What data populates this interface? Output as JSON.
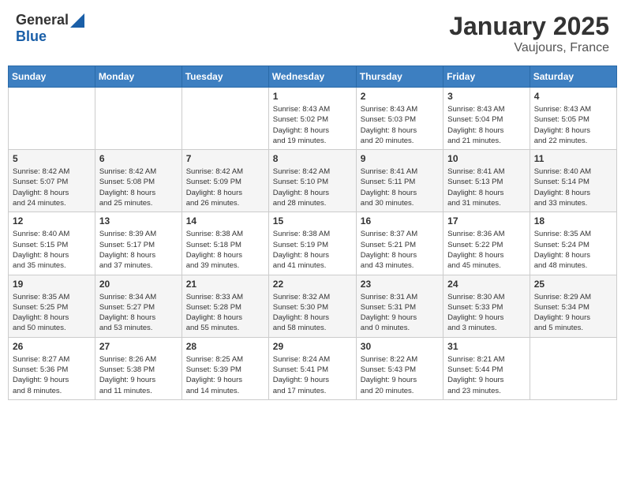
{
  "header": {
    "logo_general": "General",
    "logo_blue": "Blue",
    "month_title": "January 2025",
    "location": "Vaujours, France"
  },
  "weekdays": [
    "Sunday",
    "Monday",
    "Tuesday",
    "Wednesday",
    "Thursday",
    "Friday",
    "Saturday"
  ],
  "weeks": [
    {
      "cells": [
        {
          "day": "",
          "content": ""
        },
        {
          "day": "",
          "content": ""
        },
        {
          "day": "",
          "content": ""
        },
        {
          "day": "1",
          "content": "Sunrise: 8:43 AM\nSunset: 5:02 PM\nDaylight: 8 hours\nand 19 minutes."
        },
        {
          "day": "2",
          "content": "Sunrise: 8:43 AM\nSunset: 5:03 PM\nDaylight: 8 hours\nand 20 minutes."
        },
        {
          "day": "3",
          "content": "Sunrise: 8:43 AM\nSunset: 5:04 PM\nDaylight: 8 hours\nand 21 minutes."
        },
        {
          "day": "4",
          "content": "Sunrise: 8:43 AM\nSunset: 5:05 PM\nDaylight: 8 hours\nand 22 minutes."
        }
      ]
    },
    {
      "cells": [
        {
          "day": "5",
          "content": "Sunrise: 8:42 AM\nSunset: 5:07 PM\nDaylight: 8 hours\nand 24 minutes."
        },
        {
          "day": "6",
          "content": "Sunrise: 8:42 AM\nSunset: 5:08 PM\nDaylight: 8 hours\nand 25 minutes."
        },
        {
          "day": "7",
          "content": "Sunrise: 8:42 AM\nSunset: 5:09 PM\nDaylight: 8 hours\nand 26 minutes."
        },
        {
          "day": "8",
          "content": "Sunrise: 8:42 AM\nSunset: 5:10 PM\nDaylight: 8 hours\nand 28 minutes."
        },
        {
          "day": "9",
          "content": "Sunrise: 8:41 AM\nSunset: 5:11 PM\nDaylight: 8 hours\nand 30 minutes."
        },
        {
          "day": "10",
          "content": "Sunrise: 8:41 AM\nSunset: 5:13 PM\nDaylight: 8 hours\nand 31 minutes."
        },
        {
          "day": "11",
          "content": "Sunrise: 8:40 AM\nSunset: 5:14 PM\nDaylight: 8 hours\nand 33 minutes."
        }
      ]
    },
    {
      "cells": [
        {
          "day": "12",
          "content": "Sunrise: 8:40 AM\nSunset: 5:15 PM\nDaylight: 8 hours\nand 35 minutes."
        },
        {
          "day": "13",
          "content": "Sunrise: 8:39 AM\nSunset: 5:17 PM\nDaylight: 8 hours\nand 37 minutes."
        },
        {
          "day": "14",
          "content": "Sunrise: 8:38 AM\nSunset: 5:18 PM\nDaylight: 8 hours\nand 39 minutes."
        },
        {
          "day": "15",
          "content": "Sunrise: 8:38 AM\nSunset: 5:19 PM\nDaylight: 8 hours\nand 41 minutes."
        },
        {
          "day": "16",
          "content": "Sunrise: 8:37 AM\nSunset: 5:21 PM\nDaylight: 8 hours\nand 43 minutes."
        },
        {
          "day": "17",
          "content": "Sunrise: 8:36 AM\nSunset: 5:22 PM\nDaylight: 8 hours\nand 45 minutes."
        },
        {
          "day": "18",
          "content": "Sunrise: 8:35 AM\nSunset: 5:24 PM\nDaylight: 8 hours\nand 48 minutes."
        }
      ]
    },
    {
      "cells": [
        {
          "day": "19",
          "content": "Sunrise: 8:35 AM\nSunset: 5:25 PM\nDaylight: 8 hours\nand 50 minutes."
        },
        {
          "day": "20",
          "content": "Sunrise: 8:34 AM\nSunset: 5:27 PM\nDaylight: 8 hours\nand 53 minutes."
        },
        {
          "day": "21",
          "content": "Sunrise: 8:33 AM\nSunset: 5:28 PM\nDaylight: 8 hours\nand 55 minutes."
        },
        {
          "day": "22",
          "content": "Sunrise: 8:32 AM\nSunset: 5:30 PM\nDaylight: 8 hours\nand 58 minutes."
        },
        {
          "day": "23",
          "content": "Sunrise: 8:31 AM\nSunset: 5:31 PM\nDaylight: 9 hours\nand 0 minutes."
        },
        {
          "day": "24",
          "content": "Sunrise: 8:30 AM\nSunset: 5:33 PM\nDaylight: 9 hours\nand 3 minutes."
        },
        {
          "day": "25",
          "content": "Sunrise: 8:29 AM\nSunset: 5:34 PM\nDaylight: 9 hours\nand 5 minutes."
        }
      ]
    },
    {
      "cells": [
        {
          "day": "26",
          "content": "Sunrise: 8:27 AM\nSunset: 5:36 PM\nDaylight: 9 hours\nand 8 minutes."
        },
        {
          "day": "27",
          "content": "Sunrise: 8:26 AM\nSunset: 5:38 PM\nDaylight: 9 hours\nand 11 minutes."
        },
        {
          "day": "28",
          "content": "Sunrise: 8:25 AM\nSunset: 5:39 PM\nDaylight: 9 hours\nand 14 minutes."
        },
        {
          "day": "29",
          "content": "Sunrise: 8:24 AM\nSunset: 5:41 PM\nDaylight: 9 hours\nand 17 minutes."
        },
        {
          "day": "30",
          "content": "Sunrise: 8:22 AM\nSunset: 5:43 PM\nDaylight: 9 hours\nand 20 minutes."
        },
        {
          "day": "31",
          "content": "Sunrise: 8:21 AM\nSunset: 5:44 PM\nDaylight: 9 hours\nand 23 minutes."
        },
        {
          "day": "",
          "content": ""
        }
      ]
    }
  ]
}
